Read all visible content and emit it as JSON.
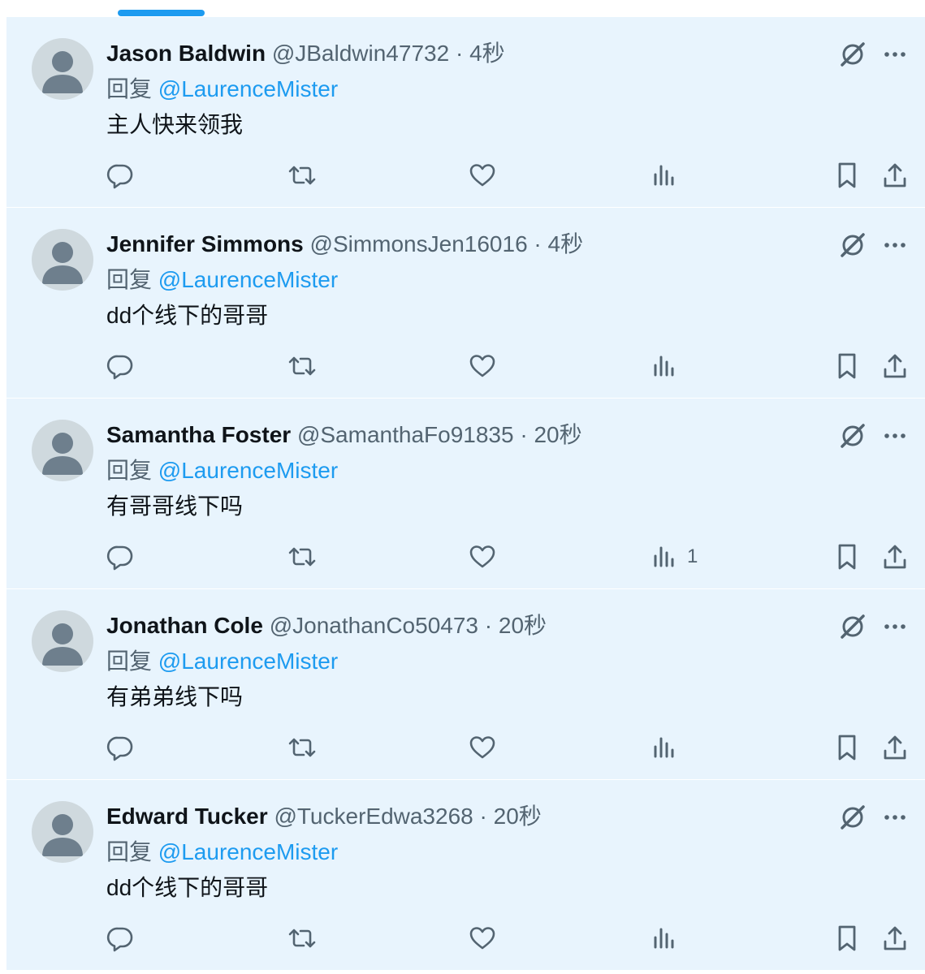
{
  "colors": {
    "accent": "#1d9bf0",
    "tweet_background": "#e8f4fd",
    "secondary_text": "#536471",
    "primary_text": "#0f1419",
    "avatar_background": "#cfd9de",
    "avatar_figure": "#6e7f8d"
  },
  "icons": {
    "reply": "reply-icon",
    "retweet": "retweet-icon",
    "like": "heart-icon",
    "views": "views-chart-icon",
    "bookmark": "bookmark-icon",
    "share": "share-icon",
    "grok": "grok-icon",
    "more": "more-dots-icon",
    "avatar": "default-avatar-icon"
  },
  "replies": [
    {
      "name": "Jason Baldwin",
      "handle": "@JBaldwin47732",
      "separator": "·",
      "time": "4秒",
      "reply_prefix": "回复",
      "reply_to": "@LaurenceMister",
      "text": "主人快来领我",
      "views": ""
    },
    {
      "name": "Jennifer Simmons",
      "handle": "@SimmonsJen16016",
      "separator": "·",
      "time": "4秒",
      "reply_prefix": "回复",
      "reply_to": "@LaurenceMister",
      "text": "dd个线下的哥哥",
      "views": ""
    },
    {
      "name": "Samantha Foster",
      "handle": "@SamanthaFo91835",
      "separator": "·",
      "time": "20秒",
      "reply_prefix": "回复",
      "reply_to": "@LaurenceMister",
      "text": "有哥哥线下吗",
      "views": "1"
    },
    {
      "name": "Jonathan Cole",
      "handle": "@JonathanCo50473",
      "separator": "·",
      "time": "20秒",
      "reply_prefix": "回复",
      "reply_to": "@LaurenceMister",
      "text": "有弟弟线下吗",
      "views": ""
    },
    {
      "name": "Edward Tucker",
      "handle": "@TuckerEdwa3268",
      "separator": "·",
      "time": "20秒",
      "reply_prefix": "回复",
      "reply_to": "@LaurenceMister",
      "text": "dd个线下的哥哥",
      "views": ""
    }
  ]
}
